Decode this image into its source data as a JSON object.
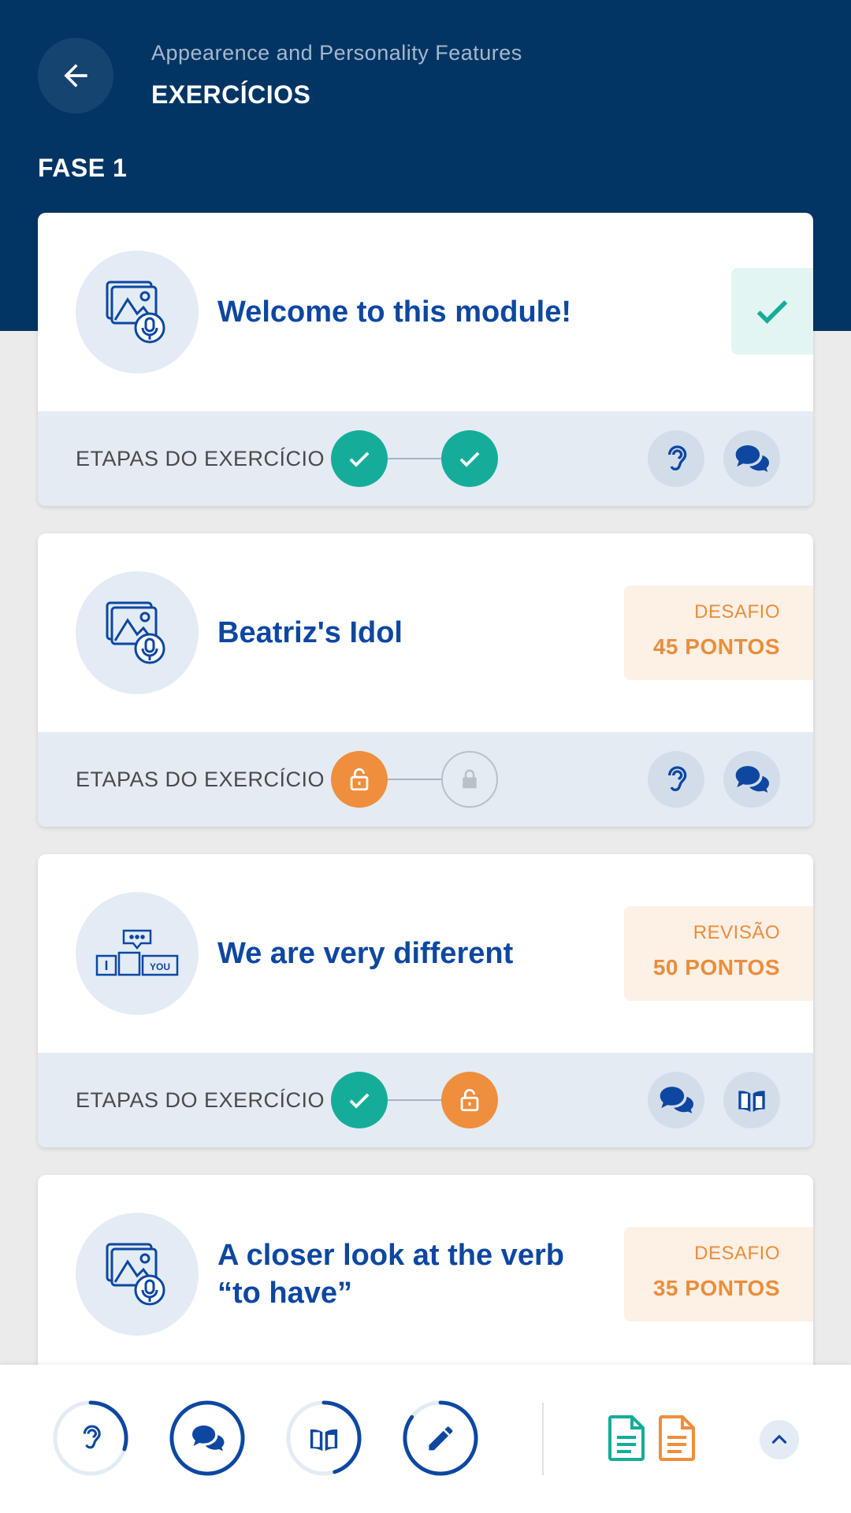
{
  "header": {
    "subtitle": "Appearence and Personality Features",
    "title": "EXERCÍCIOS",
    "phase": "FASE 1"
  },
  "exercises": [
    {
      "title": "Welcome to this module!",
      "status": "completed",
      "steps_label": "ETAPAS DO EXERCÍCIO",
      "steps": [
        "completed",
        "completed"
      ],
      "skills": [
        "ear-icon",
        "chat-icon"
      ]
    },
    {
      "title": "Beatriz's Idol",
      "badge_kind": "DESAFIO",
      "badge_points": "45 PONTOS",
      "steps_label": "ETAPAS DO EXERCÍCIO",
      "steps": [
        "unlocked",
        "locked"
      ],
      "skills": [
        "ear-icon",
        "chat-icon"
      ]
    },
    {
      "title": "We are very different",
      "badge_kind": "REVISÃO",
      "badge_points": "50 PONTOS",
      "steps_label": "ETAPAS DO EXERCÍCIO",
      "steps": [
        "completed",
        "unlocked"
      ],
      "skills": [
        "chat-icon",
        "book-icon"
      ]
    },
    {
      "title": "A closer look at the verb “to have”",
      "badge_kind": "DESAFIO",
      "badge_points": "35 PONTOS"
    }
  ],
  "progress_rings": [
    {
      "icon": "ear-icon",
      "progress": 0.3
    },
    {
      "icon": "chat-icon",
      "progress": 1.0
    },
    {
      "icon": "book-icon",
      "progress": 0.45
    },
    {
      "icon": "pencil-icon",
      "progress": 0.85
    }
  ],
  "colors": {
    "header": "#033564",
    "primary": "#0d47a1",
    "success": "#15ad99",
    "accent": "#ef8e3c"
  }
}
